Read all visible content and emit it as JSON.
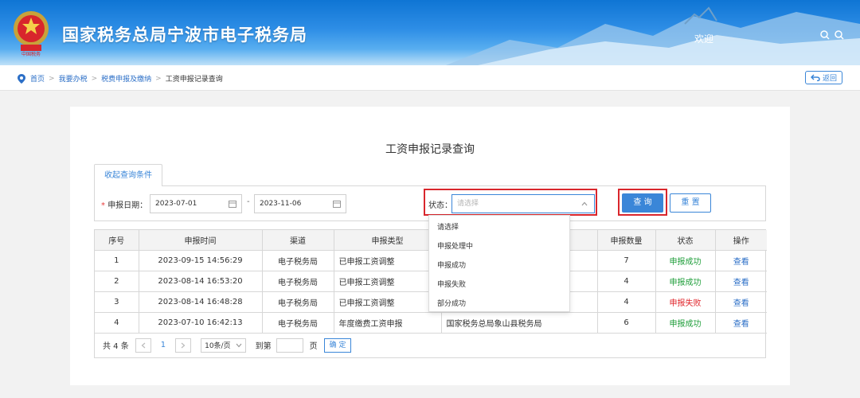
{
  "header": {
    "title": "国家税务总局宁波市电子税务局",
    "welcome": "欢迎"
  },
  "breadcrumb": {
    "items": [
      "首页",
      "我要办税",
      "税费申报及缴纳"
    ],
    "current": "工资申报记录查询",
    "back_label": "返回"
  },
  "page_title": "工资申报记录查询",
  "filter": {
    "tab_label": "收起查询条件",
    "date_label": "申报日期：",
    "required_mark": "*",
    "date_from": "2023-07-01",
    "date_to": "2023-11-06",
    "date_separator": "-",
    "status_label": "状态：",
    "status_placeholder": "请选择",
    "query_label": "查 询",
    "reset_label": "重 置"
  },
  "status_options": [
    "请选择",
    "申报处理中",
    "申报成功",
    "申报失败",
    "部分成功"
  ],
  "table": {
    "headers": [
      "序号",
      "申报时间",
      "渠道",
      "申报类型",
      "",
      "申报数量",
      "状态",
      "操作"
    ],
    "rows": [
      {
        "no": "1",
        "time": "2023-09-15 14:56:29",
        "channel": "电子税务局",
        "type": "已申报工资调整",
        "org": "",
        "count": "7",
        "status": "申报成功",
        "action": "查看"
      },
      {
        "no": "2",
        "time": "2023-08-14 16:53:20",
        "channel": "电子税务局",
        "type": "已申报工资调整",
        "org": "",
        "count": "4",
        "status": "申报成功",
        "action": "查看"
      },
      {
        "no": "3",
        "time": "2023-08-14 16:48:28",
        "channel": "电子税务局",
        "type": "已申报工资调整",
        "org": "",
        "count": "4",
        "status": "申报失败",
        "action": "查看"
      },
      {
        "no": "4",
        "time": "2023-07-10 16:42:13",
        "channel": "电子税务局",
        "type": "年度缴费工资申报",
        "org": "国家税务总局象山县税务局",
        "count": "6",
        "status": "申报成功",
        "action": "查看"
      }
    ]
  },
  "pager": {
    "total_text": "共 4 条",
    "current_page": "1",
    "page_size": "10条/页",
    "goto_label": "到第",
    "page_label": "页",
    "confirm_label": "确 定"
  },
  "colors": {
    "primary": "#3a86d8",
    "success": "#1f9e3a",
    "fail": "#e0242a",
    "highlight": "#d9262c"
  }
}
